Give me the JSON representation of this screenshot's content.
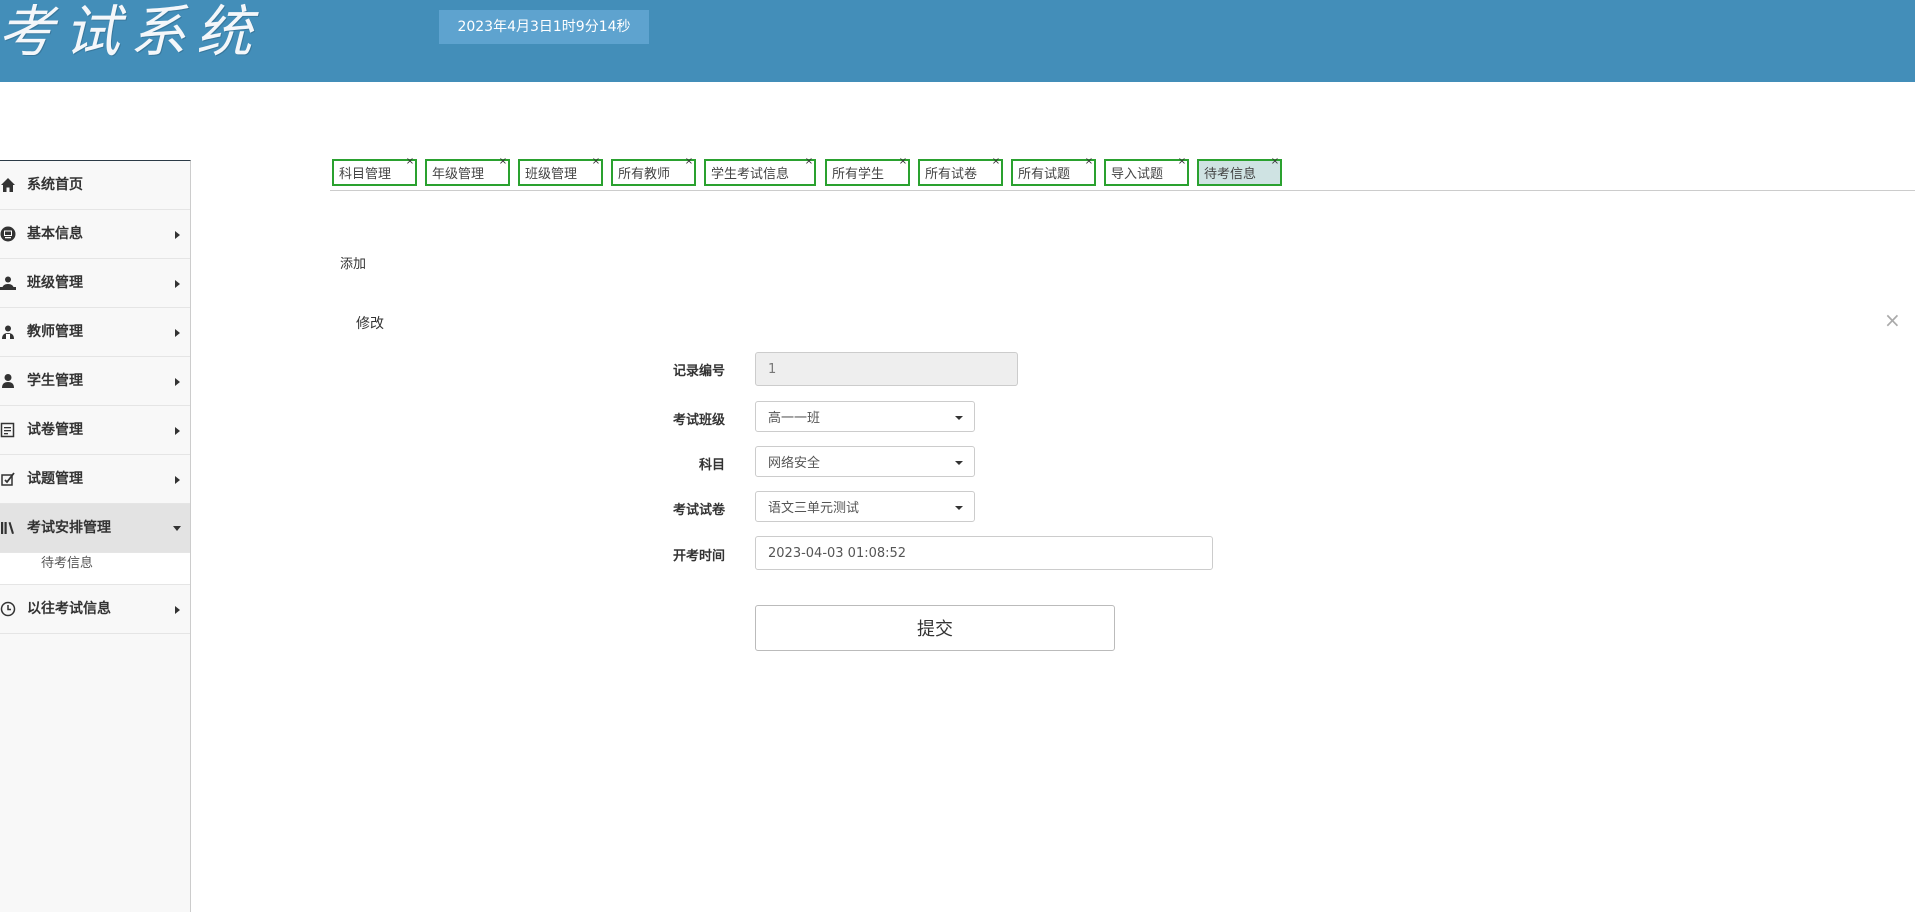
{
  "header": {
    "app_title": "考试系统",
    "clock": "2023年4月3日1时9分14秒",
    "color": "#438eb9"
  },
  "sidebar": {
    "items": [
      {
        "label": "系统首页",
        "icon": "home-icon"
      },
      {
        "label": "基本信息",
        "icon": "monitor-icon"
      },
      {
        "label": "班级管理",
        "icon": "users-icon"
      },
      {
        "label": "教师管理",
        "icon": "teacher-icon"
      },
      {
        "label": "学生管理",
        "icon": "user-icon"
      },
      {
        "label": "试卷管理",
        "icon": "paper-icon"
      },
      {
        "label": "试题管理",
        "icon": "question-icon"
      },
      {
        "label": "考试安排管理",
        "icon": "books-icon",
        "open": true
      },
      {
        "label": "以往考试信息",
        "icon": "clock-icon"
      }
    ],
    "sub_items": [
      "待考信息"
    ]
  },
  "tabs": [
    {
      "label": "科目管理"
    },
    {
      "label": "年级管理"
    },
    {
      "label": "班级管理"
    },
    {
      "label": "所有教师"
    },
    {
      "label": "学生考试信息"
    },
    {
      "label": "所有学生"
    },
    {
      "label": "所有试卷"
    },
    {
      "label": "所有试题"
    },
    {
      "label": "导入试题"
    },
    {
      "label": "待考信息",
      "active": true
    }
  ],
  "tab_close": "×",
  "toolbar": {
    "add_label": "添加"
  },
  "dialog": {
    "title": "修改",
    "close": "×",
    "fields": {
      "record_id": {
        "label": "记录编号",
        "value": "1"
      },
      "exam_class": {
        "label": "考试班级",
        "value": "高一一班"
      },
      "subject": {
        "label": "科目",
        "value": "网络安全"
      },
      "exam_paper": {
        "label": "考试试卷",
        "value": "语文三单元测试"
      },
      "start_time": {
        "label": "开考时间",
        "value": "2023-04-03 01:08:52"
      }
    },
    "submit_label": "提交"
  }
}
